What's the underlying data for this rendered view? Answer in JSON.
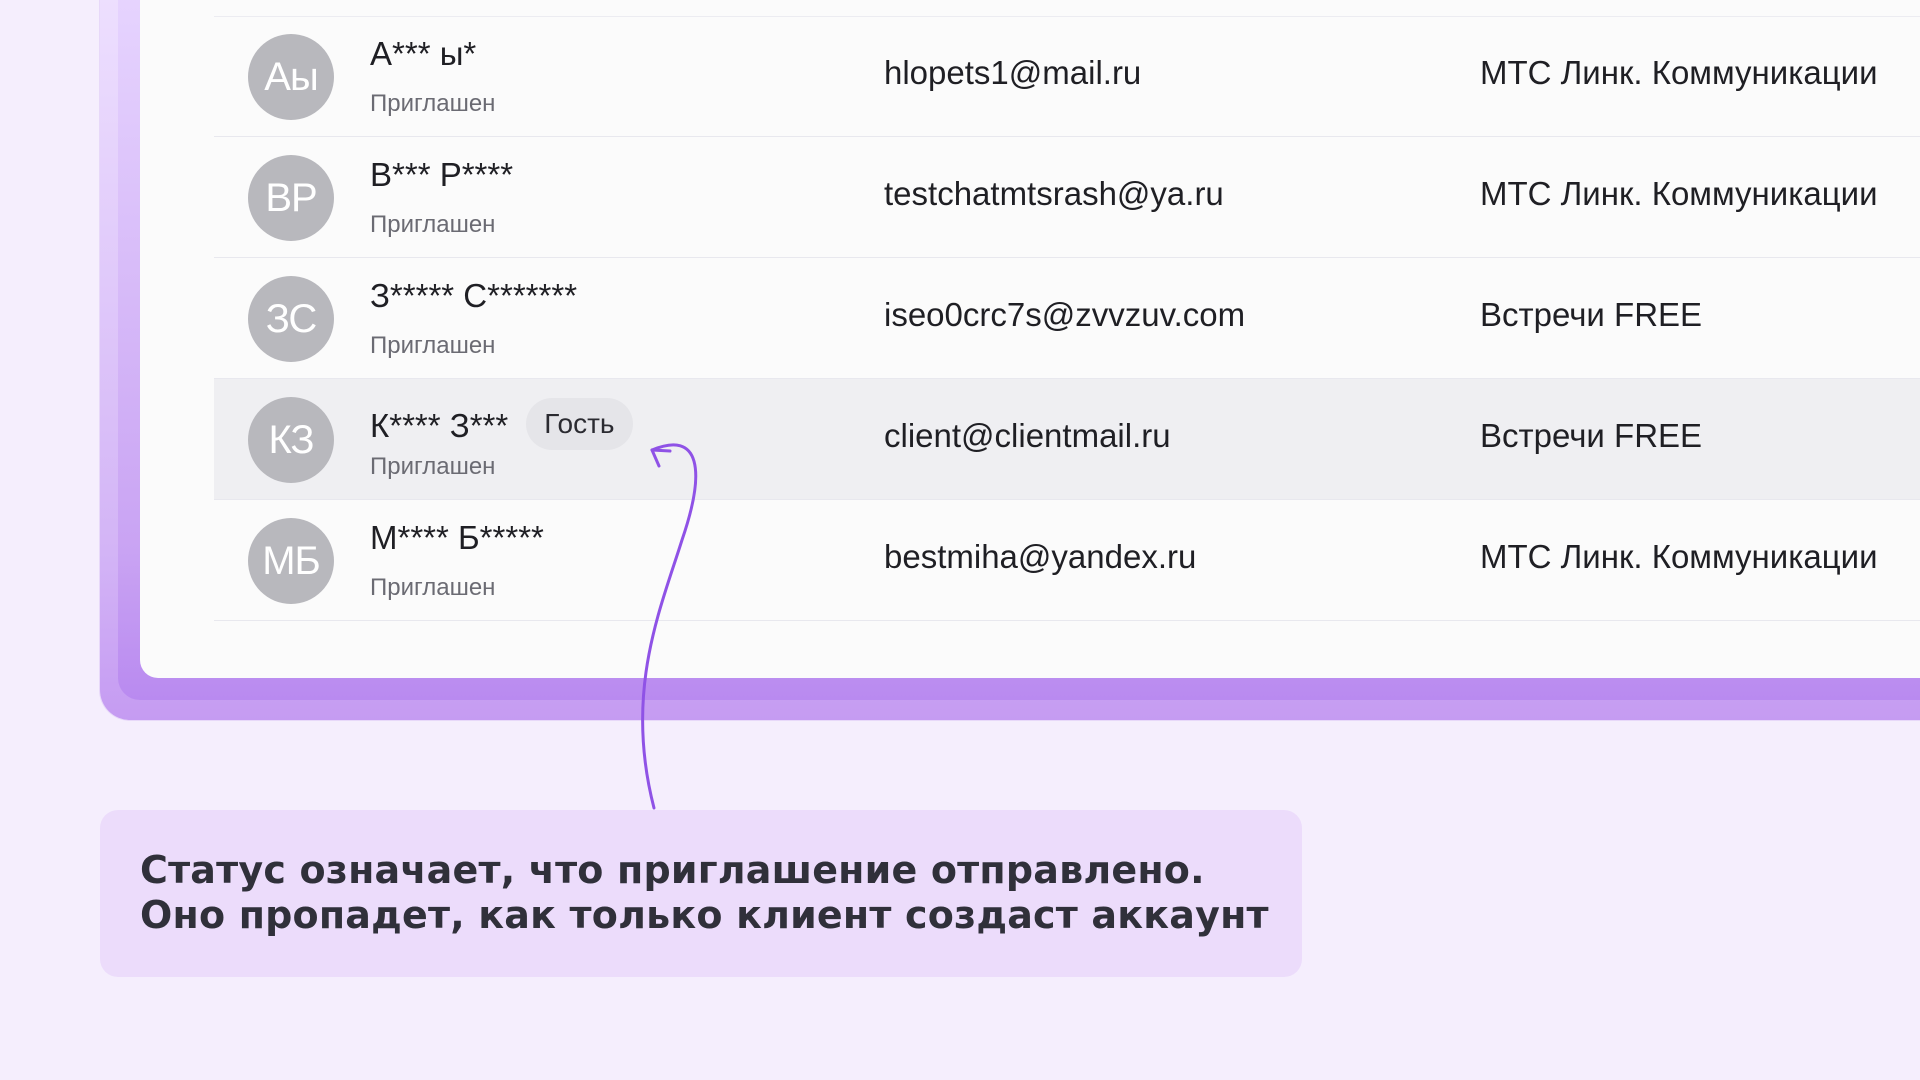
{
  "contacts": [
    {
      "initials": "Аы",
      "name": "А*** ы*",
      "status": "Приглашен",
      "email": "hlopets1@mail.ru",
      "organization": "МТС Линк. Коммуникации",
      "tag": "",
      "highlighted": false
    },
    {
      "initials": "ВР",
      "name": "В*** Р****",
      "status": "Приглашен",
      "email": "testchatmtsrash@ya.ru",
      "organization": "МТС Линк. Коммуникации",
      "tag": "",
      "highlighted": false
    },
    {
      "initials": "ЗС",
      "name": "З***** С*******",
      "status": "Приглашен",
      "email": "iseo0crc7s@zvvzuv.com",
      "organization": "Встречи FREE",
      "tag": "",
      "highlighted": false
    },
    {
      "initials": "КЗ",
      "name": "К**** З***",
      "status": "Приглашен",
      "email": "client@clientmail.ru",
      "organization": "Встречи FREE",
      "tag": "Гость",
      "highlighted": true
    },
    {
      "initials": "МБ",
      "name": "М**** Б*****",
      "status": "Приглашен",
      "email": "bestmiha@yandex.ru",
      "organization": "МТС Линк. Коммуникации",
      "tag": "",
      "highlighted": false
    }
  ],
  "callout": {
    "line1": "Статус означает, что приглашение отправлено.",
    "line2": "Оно пропадет, как только клиент создаст аккаунт"
  },
  "colors": {
    "accent": "#8f52e6",
    "background": "#f5eefd",
    "avatar": "#b8b8bd",
    "highlight_row": "#efeff2"
  }
}
